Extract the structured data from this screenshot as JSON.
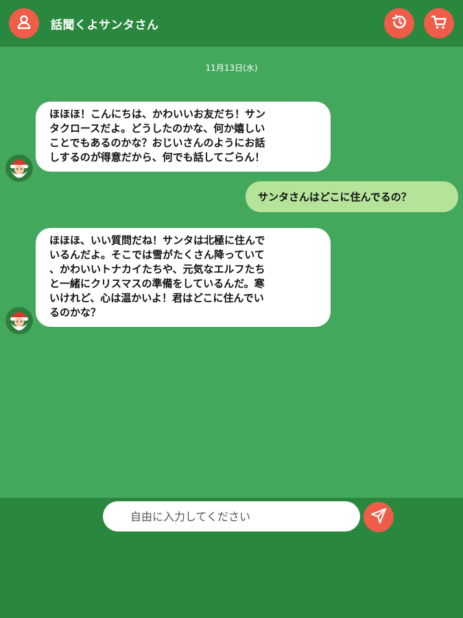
{
  "header": {
    "title": "話聞くよサンタさん",
    "accent_color": "#ef5d49",
    "background_color": "#2a873e",
    "icons": {
      "profile": "user-icon",
      "history": "history-icon",
      "cart": "cart-icon"
    }
  },
  "chat": {
    "background_color": "#43a85c",
    "date": "11月13日(水)",
    "messages": [
      {
        "sender": "santa",
        "lines": [
          "ほほほ！こんにちは、かわいいお友だち！サン",
          "タクロースだよ。どうしたのかな、何か嬉しい",
          "ことでもあるのかな？おじいさんのようにお話",
          "しするのが得意だから、何でも話してごらん！"
        ]
      },
      {
        "sender": "user",
        "text": "サンタさんはどこに住んでるの？"
      },
      {
        "sender": "santa",
        "lines": [
          "ほほほ、いい質問だね！サンタは北極に住んで",
          "いるんだよ。そこでは雪がたくさん降っていて",
          "、かわいいトナカイたちや、元気なエルフたち",
          "と一緒にクリスマスの準備をしているんだ。寒",
          "いけれど、心は温かいよ！君はどこに住んでい",
          "るのかな？"
        ]
      }
    ]
  },
  "composer": {
    "placeholder": "自由に入力してください",
    "value": "",
    "send_icon": "send-icon"
  }
}
